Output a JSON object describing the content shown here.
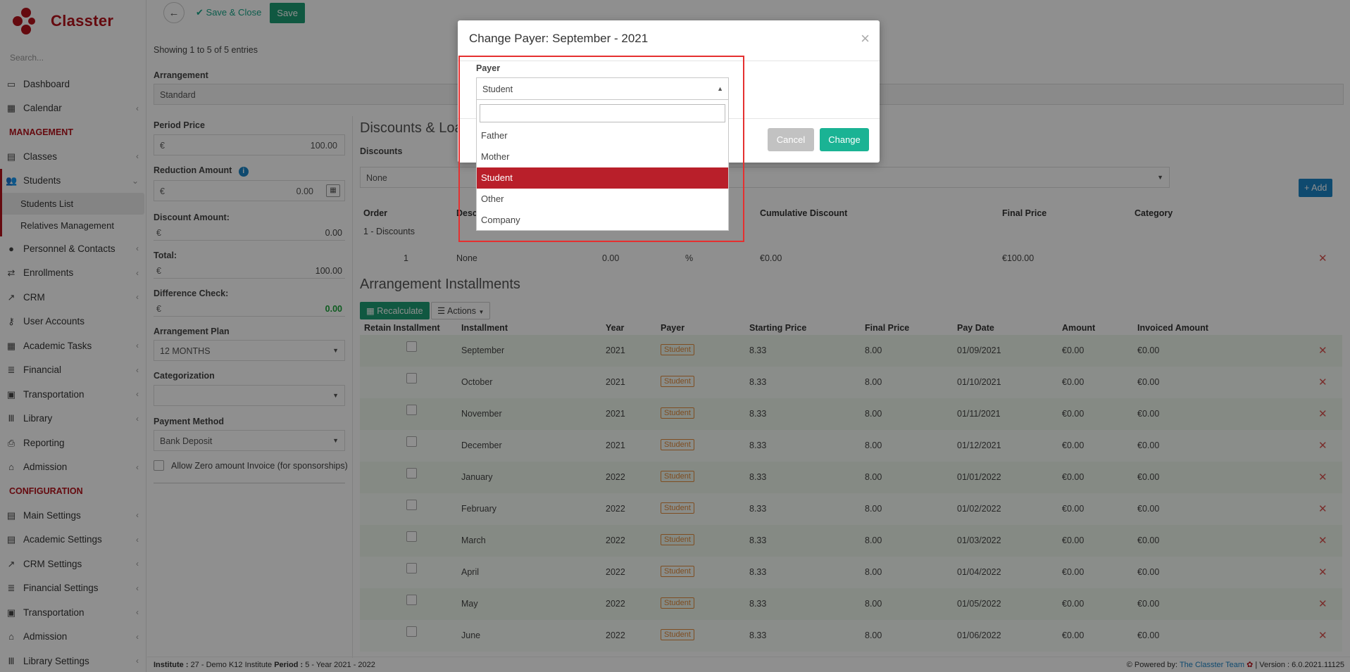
{
  "brand": {
    "name": "Classter"
  },
  "sidebar": {
    "search_placeholder": "Search...",
    "items": [
      {
        "label": "Dashboard",
        "icon": "laptop-icon"
      },
      {
        "label": "Calendar",
        "icon": "calendar-icon"
      }
    ],
    "management_label": "MANAGEMENT",
    "management_items": [
      {
        "label": "Classes"
      },
      {
        "label": "Students"
      },
      {
        "label": "Students List"
      },
      {
        "label": "Relatives Management"
      },
      {
        "label": "Personnel & Contacts"
      },
      {
        "label": "Enrollments"
      },
      {
        "label": "CRM"
      },
      {
        "label": "User Accounts"
      },
      {
        "label": "Academic Tasks"
      },
      {
        "label": "Financial"
      },
      {
        "label": "Transportation"
      },
      {
        "label": "Library"
      },
      {
        "label": "Reporting"
      },
      {
        "label": "Admission"
      }
    ],
    "configuration_label": "CONFIGURATION",
    "configuration_items": [
      {
        "label": "Main Settings"
      },
      {
        "label": "Academic Settings"
      },
      {
        "label": "CRM Settings"
      },
      {
        "label": "Financial Settings"
      },
      {
        "label": "Transportation"
      },
      {
        "label": "Admission"
      },
      {
        "label": "Library Settings"
      }
    ]
  },
  "toolbar": {
    "save_close_label": "Save & Close",
    "save_label": "Save"
  },
  "main": {
    "showing_entries": "Showing 1 to 5 of 5 entries",
    "arrangement_label": "Arrangement",
    "arrangement_value": "Standard",
    "period_price_label": "Period Price",
    "period_price_value": "100.00",
    "currency": "€",
    "reduction_amount_label": "Reduction Amount",
    "reduction_amount_value": "0.00",
    "discount_amount_label": "Discount Amount:",
    "discount_amount_value": "0.00",
    "total_label": "Total:",
    "total_value": "100.00",
    "difference_check_label": "Difference Check:",
    "difference_check_value": "0.00",
    "arrangement_plan_label": "Arrangement Plan",
    "arrangement_plan_value": "12 MONTHS",
    "categorization_label": "Categorization",
    "payment_method_label": "Payment Method",
    "payment_method_value": "Bank Deposit",
    "allow_zero_label": "Allow Zero amount Invoice (for sponsorships)",
    "discounts_loans_title": "Discounts & Loa",
    "discounts_label": "Discounts",
    "discounts_value": "None",
    "add_label": "Add",
    "discount_headers": {
      "order": "Order",
      "desc": "Desc",
      "cumulative": "Cumulative Discount",
      "final_price": "Final Price",
      "category": "Category"
    },
    "discount_group": "1 - Discounts",
    "discount_row": {
      "order": "1",
      "desc": "None",
      "value": "0.00",
      "unit": "%",
      "cumulative": "€0.00",
      "final_price": "€100.00"
    },
    "installments_title": "Arrangement Installments",
    "recalculate_label": "Recalculate",
    "actions_label": "Actions",
    "installment_headers": {
      "retain": "Retain Installment",
      "installment": "Installment",
      "year": "Year",
      "payer": "Payer",
      "starting_price": "Starting Price",
      "final_price": "Final Price",
      "pay_date": "Pay Date",
      "amount": "Amount",
      "invoiced": "Invoiced Amount"
    },
    "installments": [
      {
        "installment": "September",
        "year": "2021",
        "payer": "Student",
        "starting": "8.33",
        "final": "8.00",
        "date": "01/09/2021",
        "amount": "€0.00",
        "invoiced": "€0.00"
      },
      {
        "installment": "October",
        "year": "2021",
        "payer": "Student",
        "starting": "8.33",
        "final": "8.00",
        "date": "01/10/2021",
        "amount": "€0.00",
        "invoiced": "€0.00"
      },
      {
        "installment": "November",
        "year": "2021",
        "payer": "Student",
        "starting": "8.33",
        "final": "8.00",
        "date": "01/11/2021",
        "amount": "€0.00",
        "invoiced": "€0.00"
      },
      {
        "installment": "December",
        "year": "2021",
        "payer": "Student",
        "starting": "8.33",
        "final": "8.00",
        "date": "01/12/2021",
        "amount": "€0.00",
        "invoiced": "€0.00"
      },
      {
        "installment": "January",
        "year": "2022",
        "payer": "Student",
        "starting": "8.33",
        "final": "8.00",
        "date": "01/01/2022",
        "amount": "€0.00",
        "invoiced": "€0.00"
      },
      {
        "installment": "February",
        "year": "2022",
        "payer": "Student",
        "starting": "8.33",
        "final": "8.00",
        "date": "01/02/2022",
        "amount": "€0.00",
        "invoiced": "€0.00"
      },
      {
        "installment": "March",
        "year": "2022",
        "payer": "Student",
        "starting": "8.33",
        "final": "8.00",
        "date": "01/03/2022",
        "amount": "€0.00",
        "invoiced": "€0.00"
      },
      {
        "installment": "April",
        "year": "2022",
        "payer": "Student",
        "starting": "8.33",
        "final": "8.00",
        "date": "01/04/2022",
        "amount": "€0.00",
        "invoiced": "€0.00"
      },
      {
        "installment": "May",
        "year": "2022",
        "payer": "Student",
        "starting": "8.33",
        "final": "8.00",
        "date": "01/05/2022",
        "amount": "€0.00",
        "invoiced": "€0.00"
      },
      {
        "installment": "June",
        "year": "2022",
        "payer": "Student",
        "starting": "8.33",
        "final": "8.00",
        "date": "01/06/2022",
        "amount": "€0.00",
        "invoiced": "€0.00"
      }
    ]
  },
  "footer": {
    "institute_label": "Institute :",
    "institute_value": "27 - Demo K12 Institute",
    "period_label": "Period :",
    "period_value": "5 - Year 2021 - 2022",
    "powered_label": "Powered by:",
    "powered_value": "The Classter Team",
    "version": "| Version : 6.0.2021.11125"
  },
  "modal": {
    "title": "Change Payer: September - 2021",
    "payer_label": "Payer",
    "selected": "Student",
    "options": [
      "Father",
      "Mother",
      "Student",
      "Other",
      "Company"
    ],
    "highlighted_index": 2,
    "cancel_label": "Cancel",
    "change_label": "Change"
  },
  "colors": {
    "brand": "#b5121b",
    "accent": "#1ab394",
    "highlight": "#b91f2a",
    "annotation": "#e53030"
  }
}
